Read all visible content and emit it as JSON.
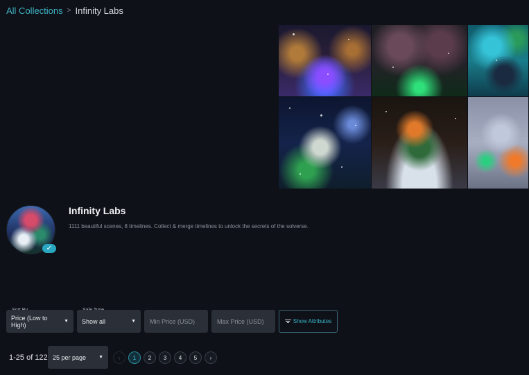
{
  "breadcrumb": {
    "parent": "All Collections",
    "separator": ">",
    "current": "Infinity Labs"
  },
  "gallery": {
    "tiles": [
      "gallery-image-1",
      "gallery-image-2",
      "gallery-image-3",
      "gallery-image-4",
      "gallery-image-5",
      "gallery-image-6"
    ]
  },
  "collection": {
    "title": "Infinity Labs",
    "description": "1111 beautiful scenes, 8 timelines. Collect & merge timelines to unlock the secrets of the solverse.",
    "verified_icon": "check-icon"
  },
  "filters": {
    "sort_label": "Sort By",
    "sort_value": "Price (Low to High)",
    "sale_label": "Sale Type",
    "sale_value": "Show all",
    "min_price_placeholder": "Min Price (USD)",
    "max_price_placeholder": "Max Price (USD)",
    "attributes_button": "Show Attributes"
  },
  "pagination": {
    "range": "1-25 of 122",
    "per_page": "25 per page",
    "prev": "‹",
    "next": "›",
    "pages": [
      "1",
      "2",
      "3",
      "4",
      "5"
    ],
    "current_page": "1"
  },
  "colors": {
    "background": "#0e1117",
    "accent": "#3fb2c4",
    "field": "#2b3038"
  }
}
